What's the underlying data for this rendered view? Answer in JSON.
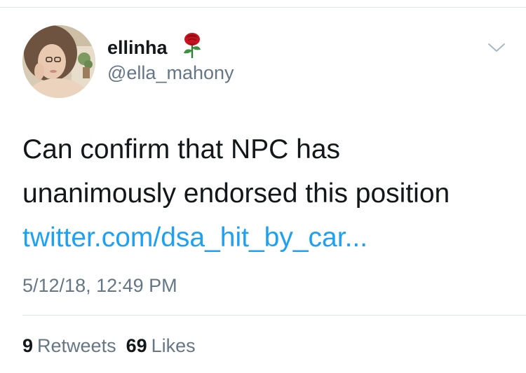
{
  "user": {
    "display_name": "ellinha",
    "handle": "@ella_mahony",
    "avatar_icon": "user-avatar",
    "name_emoji_icon": "rose-icon"
  },
  "tweet": {
    "text_lines": [
      "Can confirm that NPC has",
      "unanimously endorsed this position"
    ],
    "link_text": "twitter.com/dsa_hit_by_car...",
    "timestamp": "5/12/18, 12:49 PM"
  },
  "stats": {
    "retweets_count": "9",
    "retweets_label": "Retweets",
    "likes_count": "69",
    "likes_label": "Likes"
  },
  "menu": {
    "icon": "chevron-down-icon"
  },
  "colors": {
    "text": "#14171a",
    "secondary": "#657786",
    "link": "#1da1f2",
    "divider": "#e1e8ed"
  }
}
